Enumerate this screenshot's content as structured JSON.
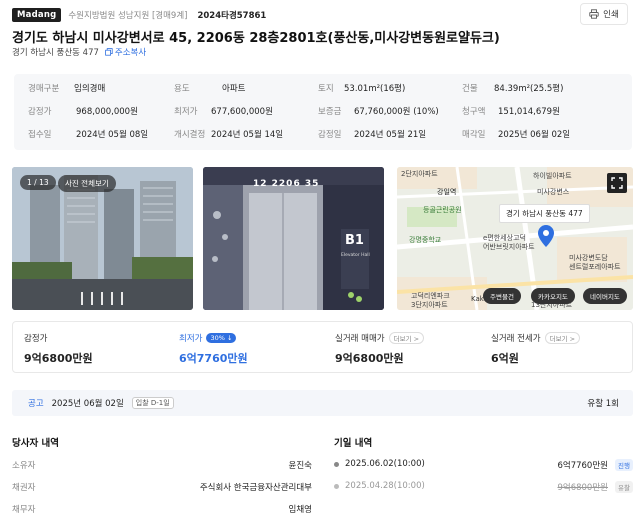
{
  "header": {
    "brand": "Madang",
    "court": "수원지방법원 성남지원 [경매9계]",
    "case_no": "2024타경57861",
    "print_label": "인쇄"
  },
  "title": "경기도 하남시 미사강변서로 45, 2206동 28층2801호(풍산동,미사강변동원로얄듀크)",
  "address": {
    "short": "경기 하남시 풍산동 477",
    "copy_label": "주소복사"
  },
  "info": [
    {
      "k": "경매구분",
      "v": "임의경매"
    },
    {
      "k": "용도",
      "v": "아파트"
    },
    {
      "k": "토지",
      "v": "53.01m²(16평)"
    },
    {
      "k": "건물",
      "v": "84.39m²(25.5평)"
    },
    {
      "k": "감정가",
      "v": "968,000,000원"
    },
    {
      "k": "최저가",
      "v": "677,600,000원"
    },
    {
      "k": "보증금",
      "v": "67,760,000원 (10%)"
    },
    {
      "k": "청구액",
      "v": "151,014,679원"
    },
    {
      "k": "접수일",
      "v": "2024년 05월 08일"
    },
    {
      "k": "개시결정",
      "v": "2024년 05월 14일"
    },
    {
      "k": "감정일",
      "v": "2024년 05월 21일"
    },
    {
      "k": "매각일",
      "v": "2025년 06월 02일"
    }
  ],
  "photos": {
    "counter": "1 / 13",
    "view_all": "사진 전체보기",
    "sign_top": "12 2206 35",
    "sign_b1": "B1",
    "sign_sub": "Elevator Hall"
  },
  "map": {
    "address_label": "경기 하남시 풍산동 477",
    "labels": [
      "2단지아파트",
      "하이빌아파트",
      "강일역",
      "미사강변스",
      "등골근린공원",
      "강명중학교",
      "e편한세상고덕",
      "어반브릿지아파트",
      "미사강변도담",
      "센트럴포레아파트",
      "고덕리엔파크",
      "3단지아파트",
      "13단지아파트",
      "Kakao"
    ],
    "buttons": [
      "주변물건",
      "카카오지도",
      "네이버지도"
    ]
  },
  "prices": {
    "appraisal_label": "감정가",
    "appraisal_value": "9억6800만원",
    "min_label": "최저가",
    "min_badge": "30% ↓",
    "min_value": "6억7760만원",
    "sale_label": "실거래 매매가",
    "sale_value": "9억6800만원",
    "rent_label": "실거래 전세가",
    "rent_value": "6억원",
    "more_label": "더보기 >"
  },
  "notice": {
    "label": "공고",
    "date": "2025년 06월 02일",
    "dday": "입찰 D-1일",
    "fail": "유찰 1회"
  },
  "parties": {
    "title": "당사자 내역",
    "rows": [
      {
        "k": "소유자",
        "v": "윤진숙"
      },
      {
        "k": "채권자",
        "v": "주식회사 한국금융자산관리대부"
      },
      {
        "k": "채무자",
        "v": "임채영"
      }
    ]
  },
  "history": {
    "title": "기일 내역",
    "rows": [
      {
        "date": "2025.06.02(10:00)",
        "value": "6억7760만원",
        "status": "진행"
      },
      {
        "date": "2025.04.28(10:00)",
        "value": "9억6800만원",
        "status": "유찰"
      }
    ]
  },
  "colors": {
    "accent": "#2f6fe0",
    "brand_bg": "#1f1f1f",
    "info_bg": "#f6f7f9",
    "progress_badge": "#e8f0fd",
    "fail_badge": "#f1f1f1"
  }
}
